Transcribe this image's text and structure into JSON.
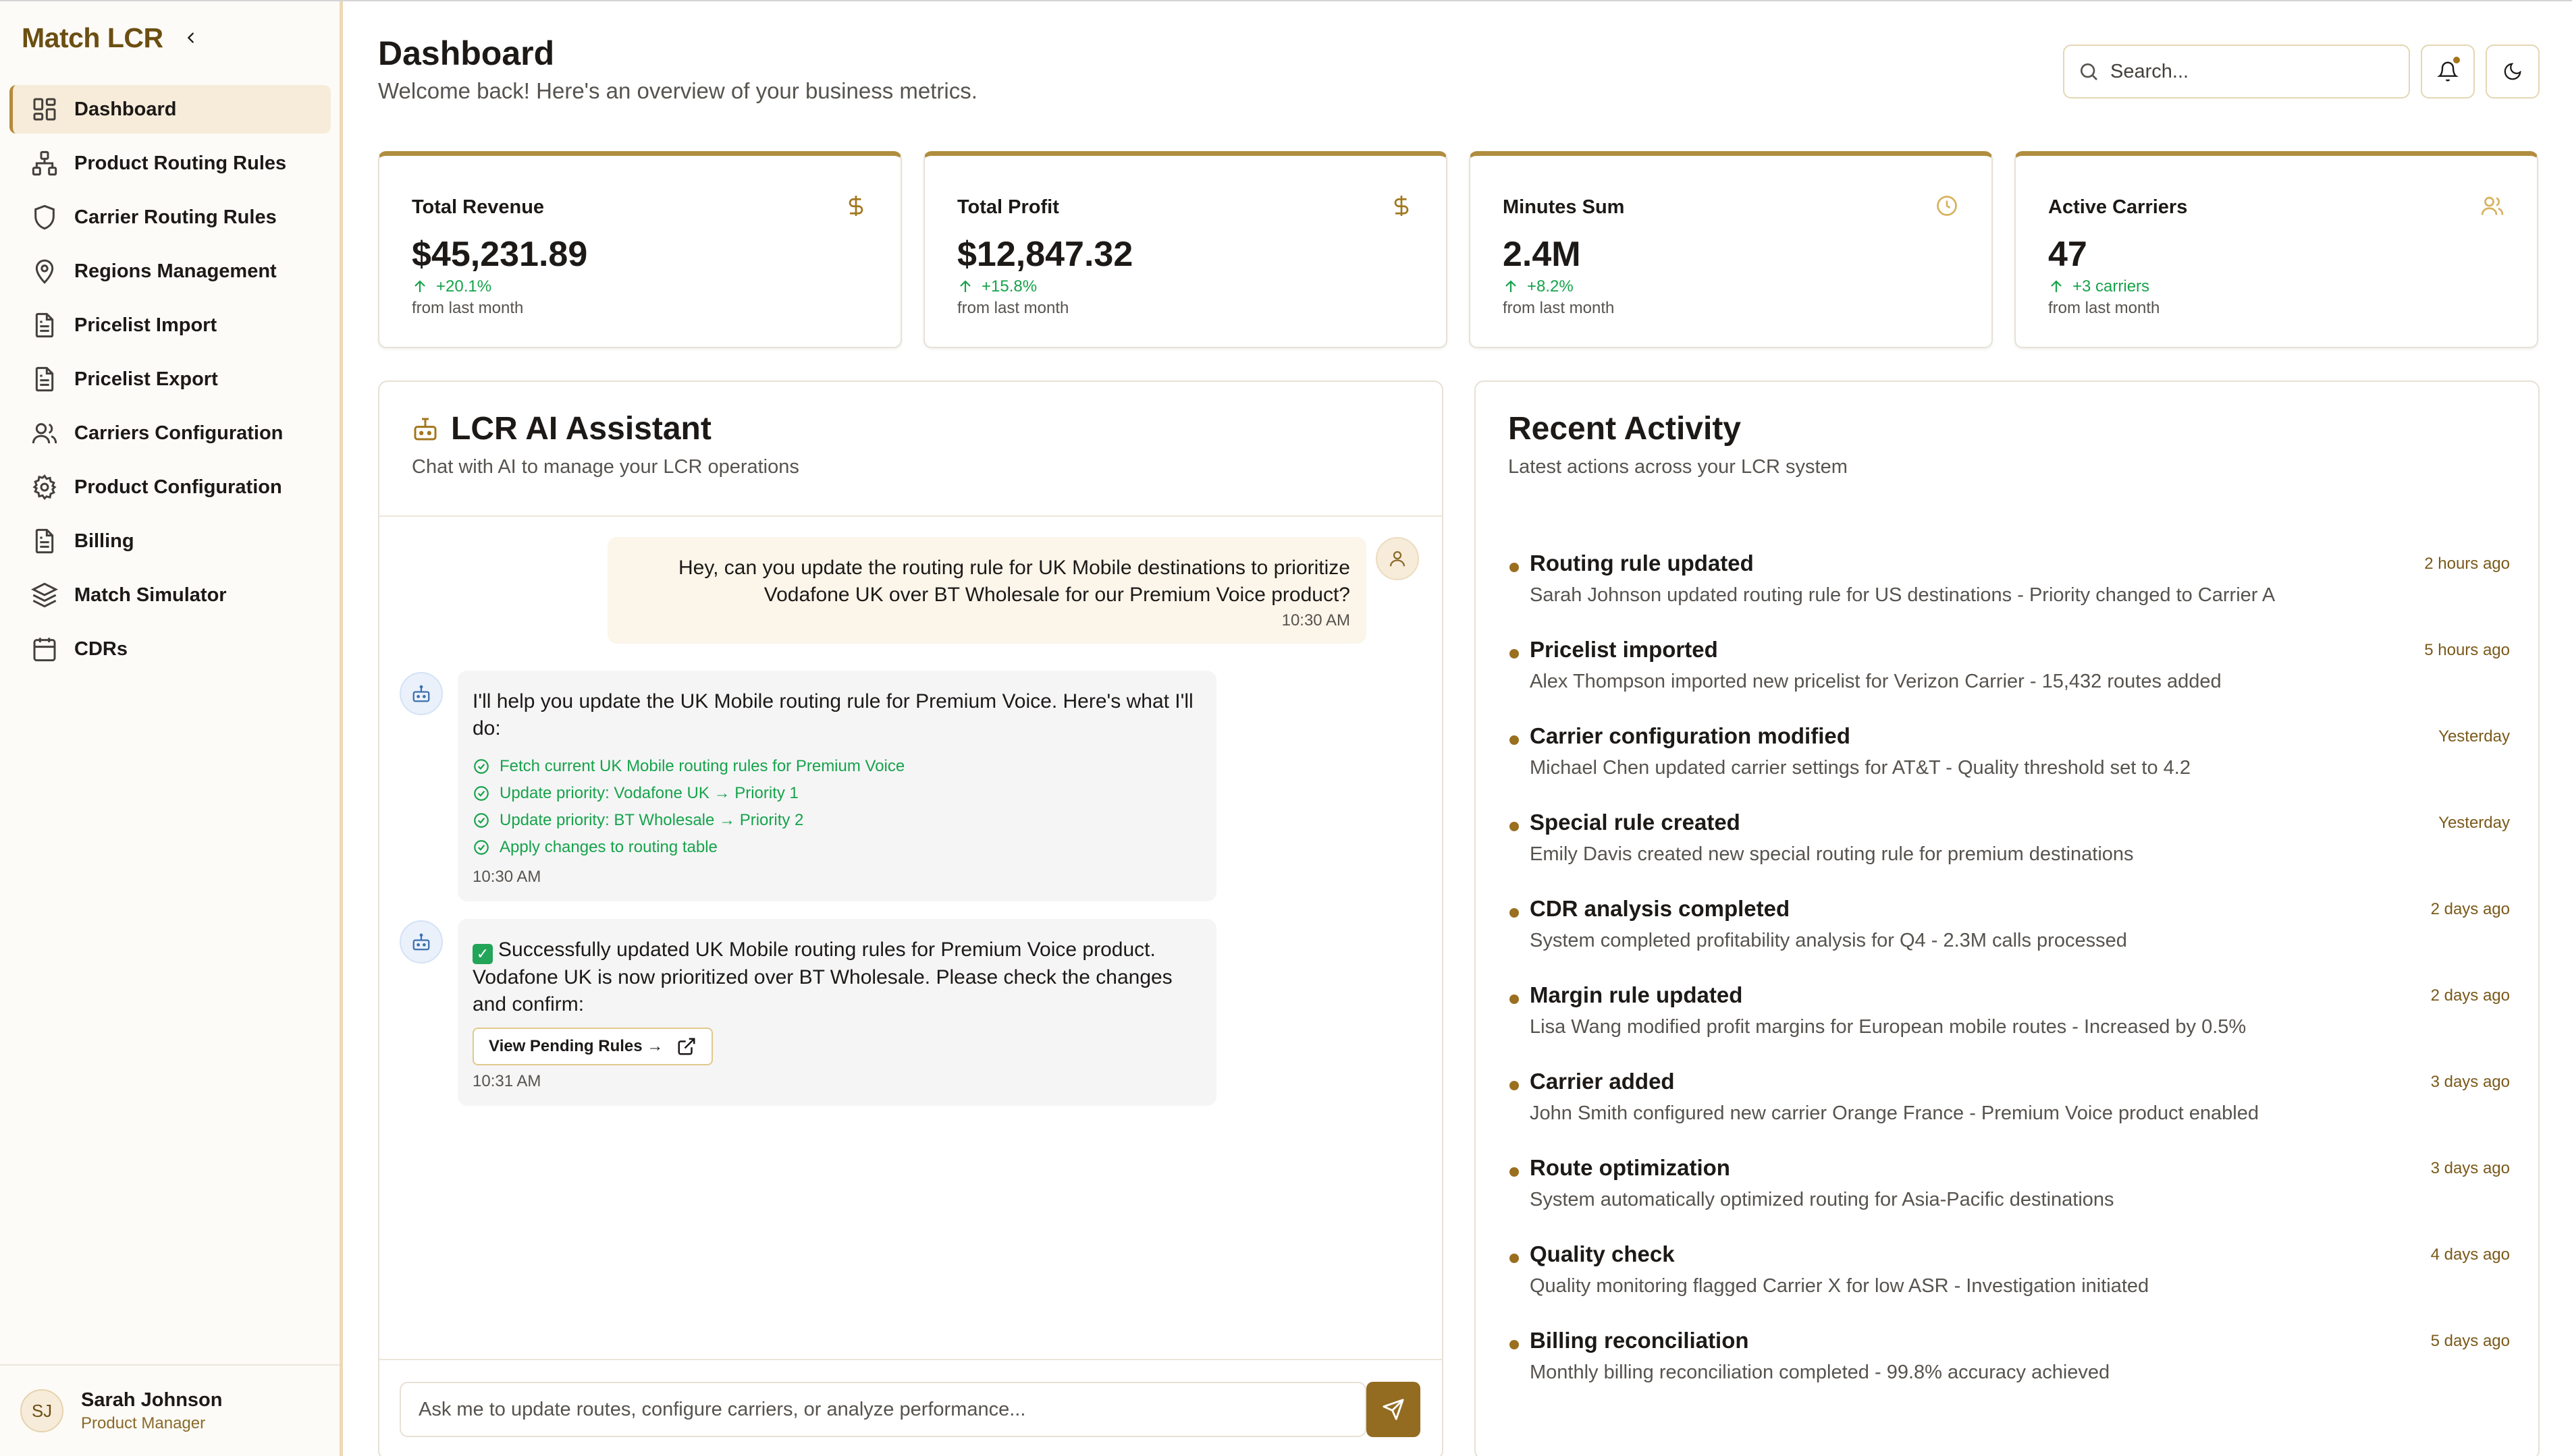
{
  "app": {
    "brand": "Match LCR"
  },
  "sidebar": {
    "items": [
      {
        "label": "Dashboard",
        "icon": "dashboard-grid-icon",
        "active": true
      },
      {
        "label": "Product Routing Rules",
        "icon": "network-icon"
      },
      {
        "label": "Carrier Routing Rules",
        "icon": "shield-icon"
      },
      {
        "label": "Regions Management",
        "icon": "map-pin-icon"
      },
      {
        "label": "Pricelist Import",
        "icon": "document-icon"
      },
      {
        "label": "Pricelist Export",
        "icon": "document-icon"
      },
      {
        "label": "Carriers Configuration",
        "icon": "users-icon"
      },
      {
        "label": "Product Configuration",
        "icon": "gear-icon"
      },
      {
        "label": "Billing",
        "icon": "document-icon"
      },
      {
        "label": "Match Simulator",
        "icon": "layers-icon"
      },
      {
        "label": "CDRs",
        "icon": "calendar-icon"
      }
    ],
    "user": {
      "initials": "SJ",
      "name": "Sarah Johnson",
      "role": "Product Manager"
    }
  },
  "header": {
    "title": "Dashboard",
    "subtitle": "Welcome back! Here's an overview of your business metrics.",
    "search_placeholder": "Search..."
  },
  "stats": [
    {
      "label": "Total Revenue",
      "value": "$45,231.89",
      "change": "+20.1%",
      "from": "from last month",
      "icon": "dollar-icon"
    },
    {
      "label": "Total Profit",
      "value": "$12,847.32",
      "change": "+15.8%",
      "from": "from last month",
      "icon": "dollar-icon"
    },
    {
      "label": "Minutes Sum",
      "value": "2.4M",
      "change": "+8.2%",
      "from": "from last month",
      "icon": "clock-icon"
    },
    {
      "label": "Active Carriers",
      "value": "47",
      "change": "+3 carriers",
      "from": "from last month",
      "icon": "users-icon"
    }
  ],
  "assistant": {
    "title": "LCR AI Assistant",
    "subtitle": "Chat with AI to manage your LCR operations",
    "messages": {
      "user1": {
        "text": "Hey, can you update the routing rule for UK Mobile destinations to prioritize Vodafone UK over BT Wholesale for our Premium Voice product?",
        "time": "10:30 AM"
      },
      "bot1": {
        "text": "I'll help you update the UK Mobile routing rule for Premium Voice. Here's what I'll do:",
        "steps": [
          "Fetch current UK Mobile routing rules for Premium Voice",
          "Update priority: Vodafone UK → Priority 1",
          "Update priority: BT Wholesale → Priority 2",
          "Apply changes to routing table"
        ],
        "time": "10:30 AM"
      },
      "bot2": {
        "emoji": "✓",
        "text": "Successfully updated UK Mobile routing rules for Premium Voice product. Vodafone UK is now prioritized over BT Wholesale. Please check the changes and confirm:",
        "button": "View Pending Rules →",
        "time": "10:31 AM"
      }
    },
    "input_placeholder": "Ask me to update routes, configure carriers, or analyze performance..."
  },
  "activity": {
    "title": "Recent Activity",
    "subtitle": "Latest actions across your LCR system",
    "items": [
      {
        "title": "Routing rule updated",
        "desc": "Sarah Johnson updated routing rule for US destinations - Priority changed to Carrier A",
        "time": "2 hours ago"
      },
      {
        "title": "Pricelist imported",
        "desc": "Alex Thompson imported new pricelist for Verizon Carrier - 15,432 routes added",
        "time": "5 hours ago"
      },
      {
        "title": "Carrier configuration modified",
        "desc": "Michael Chen updated carrier settings for AT&T - Quality threshold set to 4.2",
        "time": "Yesterday"
      },
      {
        "title": "Special rule created",
        "desc": "Emily Davis created new special routing rule for premium destinations",
        "time": "Yesterday"
      },
      {
        "title": "CDR analysis completed",
        "desc": "System completed profitability analysis for Q4 - 2.3M calls processed",
        "time": "2 days ago"
      },
      {
        "title": "Margin rule updated",
        "desc": "Lisa Wang modified profit margins for European mobile routes - Increased by 0.5%",
        "time": "2 days ago"
      },
      {
        "title": "Carrier added",
        "desc": "John Smith configured new carrier Orange France - Premium Voice product enabled",
        "time": "3 days ago"
      },
      {
        "title": "Route optimization",
        "desc": "System automatically optimized routing for Asia-Pacific destinations",
        "time": "3 days ago"
      },
      {
        "title": "Quality check",
        "desc": "Quality monitoring flagged Carrier X for low ASR - Investigation initiated",
        "time": "4 days ago"
      },
      {
        "title": "Billing reconciliation",
        "desc": "Monthly billing reconciliation completed - 99.8% accuracy achieved",
        "time": "5 days ago"
      }
    ]
  },
  "colors": {
    "accent": "#936c21",
    "brand": "#6b4f12",
    "positive": "#16a34a"
  }
}
